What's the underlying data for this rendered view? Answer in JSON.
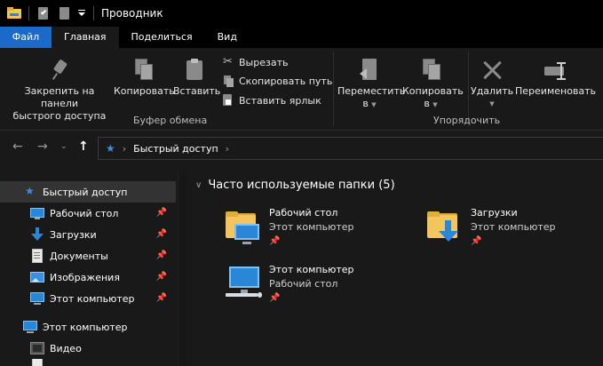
{
  "window": {
    "title": "Проводник"
  },
  "tabs": [
    {
      "label": "Файл"
    },
    {
      "label": "Главная"
    },
    {
      "label": "Поделиться"
    },
    {
      "label": "Вид"
    }
  ],
  "ribbon": {
    "clipboard": {
      "pin_label_1": "Закрепить на панели",
      "pin_label_2": "быстрого доступа",
      "copy_label": "Копировать",
      "paste_label": "Вставить",
      "cut_label": "Вырезать",
      "copy_path_label": "Скопировать путь",
      "paste_shortcut_label": "Вставить ярлык",
      "group_label": "Буфер обмена"
    },
    "organize": {
      "move_label_1": "Переместить",
      "move_label_2": "в",
      "copy_to_label_1": "Копировать",
      "copy_to_label_2": "в",
      "delete_label": "Удалить",
      "rename_label": "Переименовать",
      "group_label": "Упорядочить"
    }
  },
  "address": {
    "breadcrumb": "Быстрый доступ"
  },
  "navpane": {
    "items": [
      {
        "label": "Быстрый доступ",
        "icon": "star-icon",
        "pinned": false
      },
      {
        "label": "Рабочий стол",
        "icon": "desktop-icon",
        "pinned": true
      },
      {
        "label": "Загрузки",
        "icon": "downloads-icon",
        "pinned": true
      },
      {
        "label": "Документы",
        "icon": "documents-icon",
        "pinned": true
      },
      {
        "label": "Изображения",
        "icon": "pictures-icon",
        "pinned": true
      },
      {
        "label": "Этот компьютер",
        "icon": "computer-icon",
        "pinned": true
      },
      {
        "label": "Этот компьютер",
        "icon": "computer-icon",
        "pinned": false
      },
      {
        "label": "Видео",
        "icon": "video-icon",
        "pinned": false
      }
    ]
  },
  "content": {
    "group_header": "Часто используемые папки (5)",
    "tiles": [
      {
        "name": "Рабочий стол",
        "sub": "Этот компьютер",
        "icon": "desktop-folder-icon"
      },
      {
        "name": "Загрузки",
        "sub": "Этот компьютер",
        "icon": "downloads-folder-icon"
      },
      {
        "name": "Этот компьютер",
        "sub": "Рабочий стол",
        "icon": "computer-icon"
      }
    ]
  },
  "colors": {
    "accent": "#1b6ac9",
    "background": "#191919",
    "titlebar": "#000000",
    "selection": "#333333",
    "folder": "#f4c55c"
  }
}
